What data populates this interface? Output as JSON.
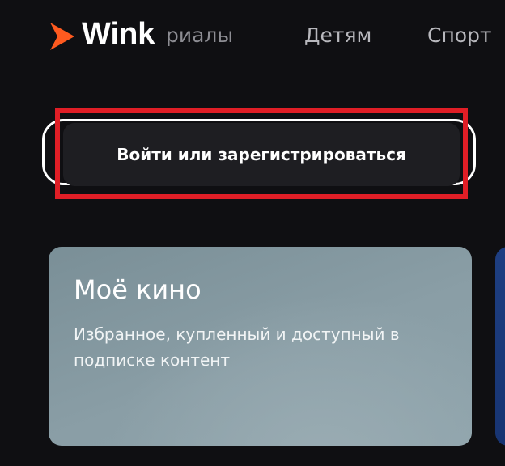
{
  "header": {
    "logo_text": "Wink",
    "nav": {
      "partial_label": "риалы",
      "kids_label": "Детям",
      "sport_label": "Спорт"
    }
  },
  "login": {
    "button_label": "Войти или зарегистрироваться"
  },
  "cards": {
    "my_movies": {
      "title": "Моё кино",
      "description": "Избранное, купленный и доступный в подписке контент"
    }
  },
  "colors": {
    "brand_orange": "#ff5a1f",
    "highlight_red": "#e01e26",
    "background": "#0f0f12",
    "next_card_blue": "#1e3f82"
  }
}
